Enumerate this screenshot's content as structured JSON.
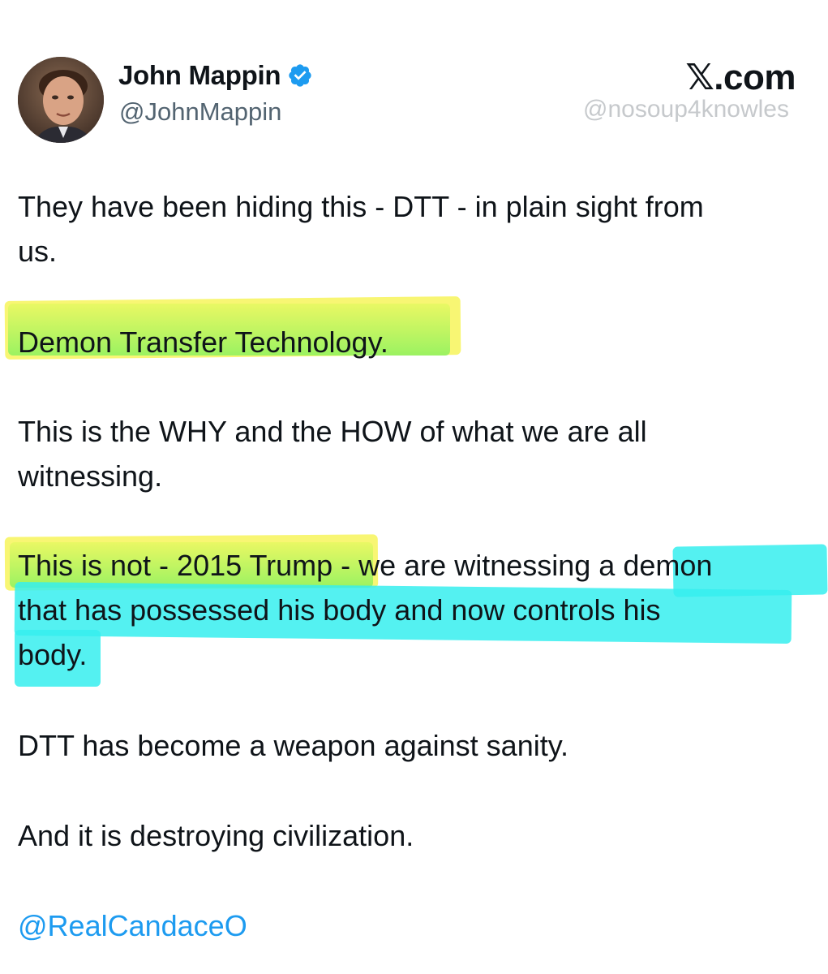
{
  "author": {
    "display_name": "John Mappin",
    "handle": "@JohnMappin",
    "verified_icon": "verified-badge-icon",
    "verified_color": "#1d9bf0"
  },
  "source": {
    "site": "𝕏.com",
    "watermark": "@nosoup4knowles"
  },
  "post": {
    "lines": [
      "They have been hiding this -  DTT - in plain sight from",
      "us.",
      "Demon Transfer Technology.",
      "This is the WHY and the HOW of what we are all",
      "witnessing.",
      "This is not - 2015 Trump - we are witnessing a demon",
      "that has possessed his body and now controls his",
      "body.",
      "DTT has become a weapon against sanity.",
      "And it is destroying civilization."
    ],
    "mention": "@RealCandaceO"
  },
  "highlight_colors": {
    "green": "#a8f060",
    "yellow": "#f4f36c",
    "cyan": "#36eeee"
  }
}
